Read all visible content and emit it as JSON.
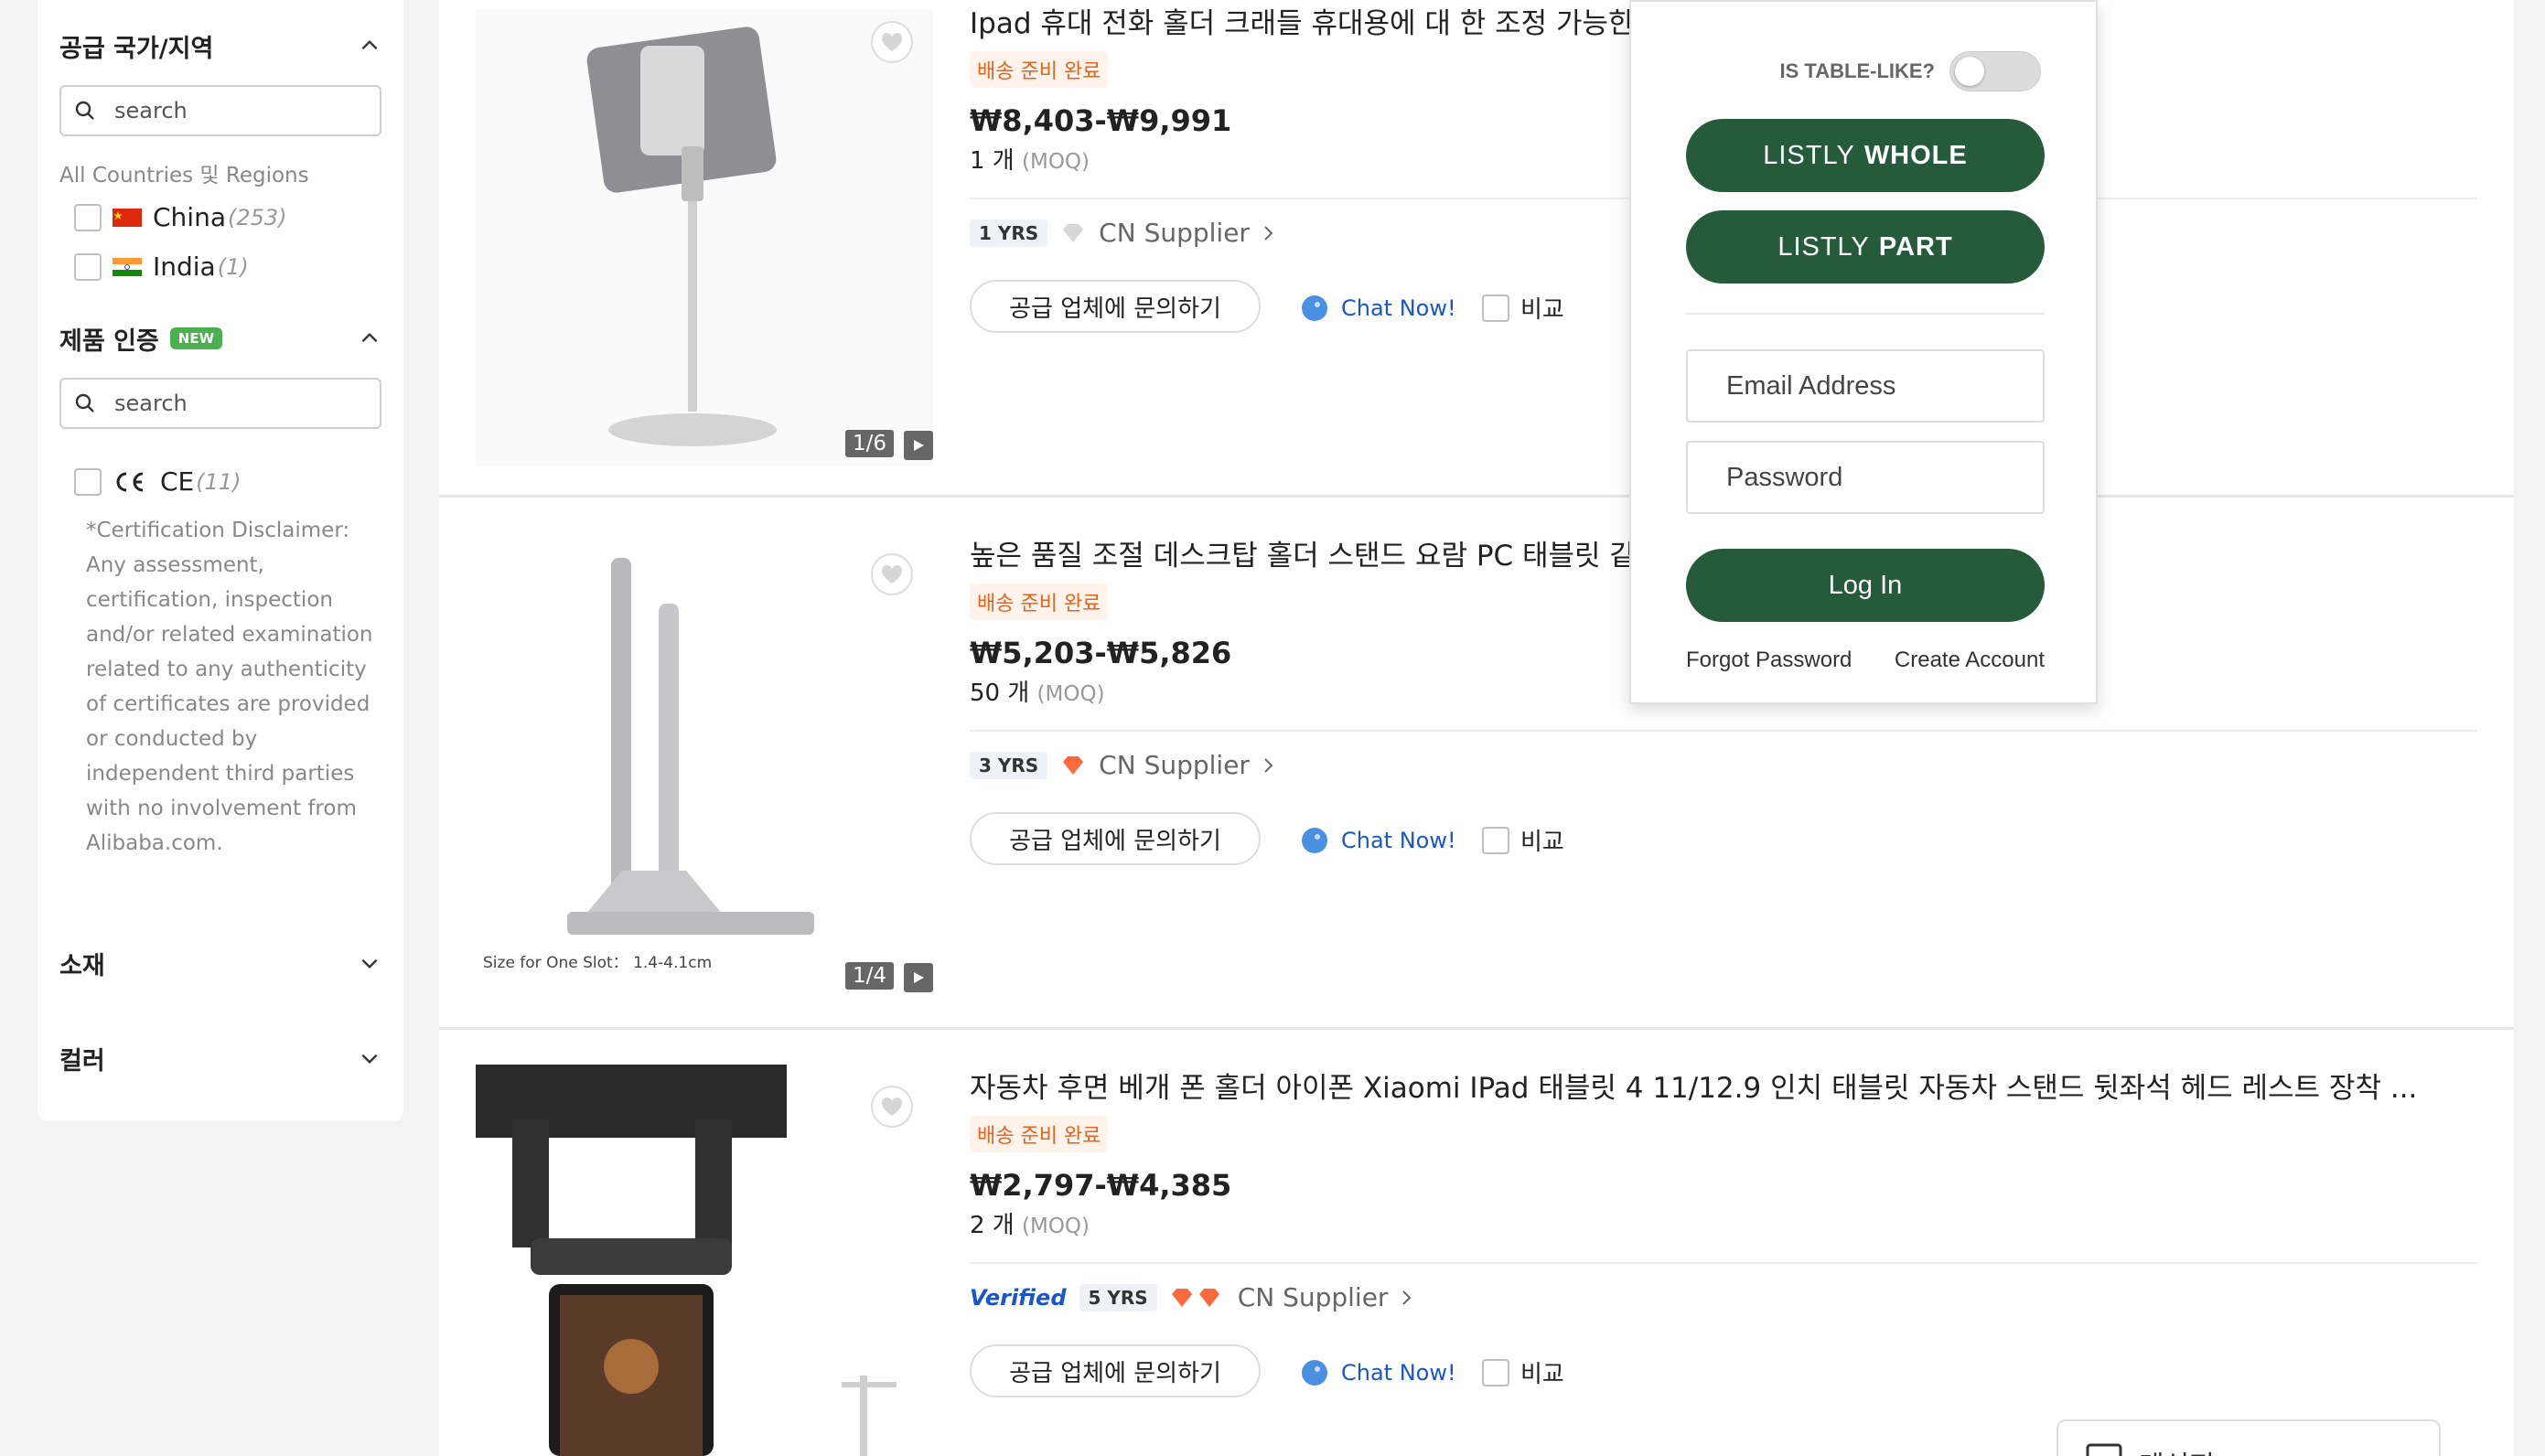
{
  "sidebar": {
    "supplier_region": {
      "title": "공급 국가/지역",
      "search_placeholder": "search",
      "all_label": "All Countries 및 Regions",
      "options": [
        {
          "label": "China",
          "count": "(253)"
        },
        {
          "label": "India",
          "count": "(1)"
        }
      ]
    },
    "certification": {
      "title": "제품 인증",
      "badge": "NEW",
      "search_placeholder": "search",
      "options": [
        {
          "label": "CE",
          "count": "(11)"
        }
      ],
      "disclaimer": "*Certification Disclaimer: Any assessment, certification, inspection and/or related examination related to any authenticity of certificates are provided or conducted by independent third parties with no involvement from Alibaba.com."
    },
    "material": {
      "title": "소재"
    },
    "color": {
      "title": "컬러"
    }
  },
  "products": [
    {
      "title": "Ipad 휴대 전화 홀더 크래들 휴대용에 대 한 조정 가능한 휴",
      "shipping": "배송 준비 완료",
      "price": "₩8,403-₩9,991",
      "moq_qty": "1 개",
      "moq_label": "(MOQ)",
      "years": "1 YRS",
      "supplier": "CN Supplier",
      "inquire": "공급 업체에 문의하기",
      "chat": "Chat Now!",
      "compare": "비교",
      "image_count": "1/6"
    },
    {
      "title": "높은 품질 조절 데스크탑 홀더 스탠드 요람 PC 태블릿 같은",
      "shipping": "배송 준비 완료",
      "price": "₩5,203-₩5,826",
      "moq_qty": "50 개",
      "moq_label": "(MOQ)",
      "years": "3 YRS",
      "supplier": "CN Supplier",
      "inquire": "공급 업체에 문의하기",
      "chat": "Chat Now!",
      "compare": "비교",
      "image_count": "1/4",
      "image_caption": "Size for One Slot： 1.4-4.1cm"
    },
    {
      "title": "자동차 후면 베개 폰 홀더 아이폰 Xiaomi IPad 태블릿 4 11/12.9 인치 태블릿 자동차 스탠드 뒷좌석 헤드 레스트 장착 ...",
      "shipping": "배송 준비 완료",
      "price": "₩2,797-₩4,385",
      "moq_qty": "2 개",
      "moq_label": "(MOQ)",
      "verified": "Verified",
      "years": "5 YRS",
      "supplier": "CN Supplier",
      "inquire": "공급 업체에 문의하기",
      "chat": "Chat Now!",
      "compare": "비교"
    }
  ],
  "listly": {
    "table_like_label": "IS TABLE-LIKE?",
    "table_like_on": false,
    "whole_prefix": "LISTLY",
    "whole_label": "WHOLE",
    "part_prefix": "LISTLY",
    "part_label": "PART",
    "email_placeholder": "Email Address",
    "password_placeholder": "Password",
    "login_label": "Log In",
    "forgot_label": "Forgot Password",
    "create_label": "Create Account"
  },
  "messenger": {
    "label": "메신저"
  },
  "colors": {
    "accent_green": "#255a3a",
    "shipping_orange": "#e1651f",
    "link_blue": "#1a56c8"
  }
}
